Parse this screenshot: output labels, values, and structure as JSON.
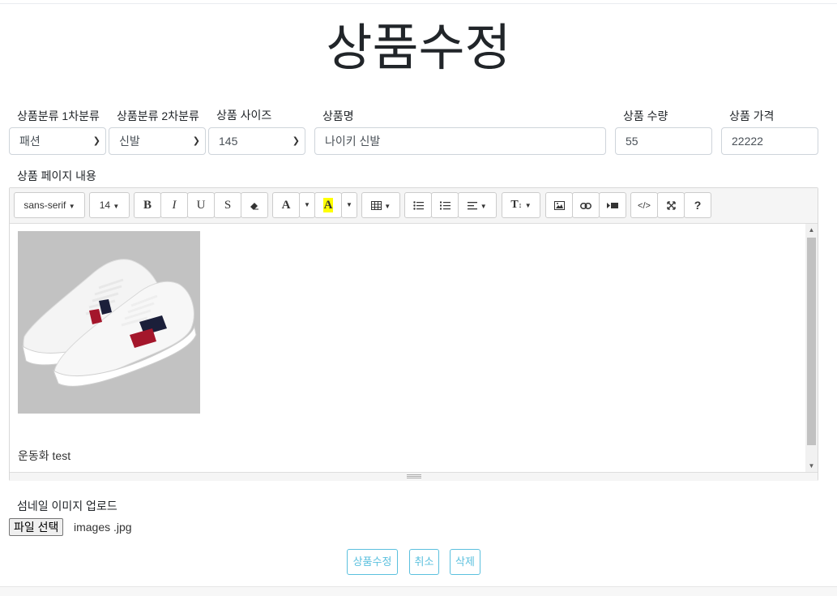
{
  "page": {
    "title": "상품수정"
  },
  "fields": {
    "category1": {
      "label": "상품분류 1차분류",
      "value": "패션"
    },
    "category2": {
      "label": "상품분류 2차분류",
      "value": "신발"
    },
    "size": {
      "label": "상품 사이즈",
      "value": "145"
    },
    "name": {
      "label": "상품명",
      "value": "나이키 신발"
    },
    "quantity": {
      "label": "상품 수량",
      "value": "55"
    },
    "price": {
      "label": "상품 가격",
      "value": "22222"
    }
  },
  "editor": {
    "label": "상품 페이지 내용",
    "toolbar": {
      "font_family": "sans-serif",
      "font_size": "14",
      "bold": "B",
      "italic": "I",
      "underline": "U",
      "strike": "S",
      "font_color": "A",
      "highlight": "A",
      "text_size": "T"
    },
    "content_text": "운동화 test"
  },
  "thumbnail": {
    "label": "섬네일 이미지 업로드",
    "file_button": "파일 선택",
    "file_name": "images .jpg"
  },
  "actions": {
    "update": "상품수정",
    "cancel": "취소",
    "delete": "삭제"
  },
  "colors": {
    "accent": "#5bc0de",
    "highlight": "#ffff00",
    "stripe_navy": "#1b1f3a",
    "stripe_red": "#a4162b"
  }
}
